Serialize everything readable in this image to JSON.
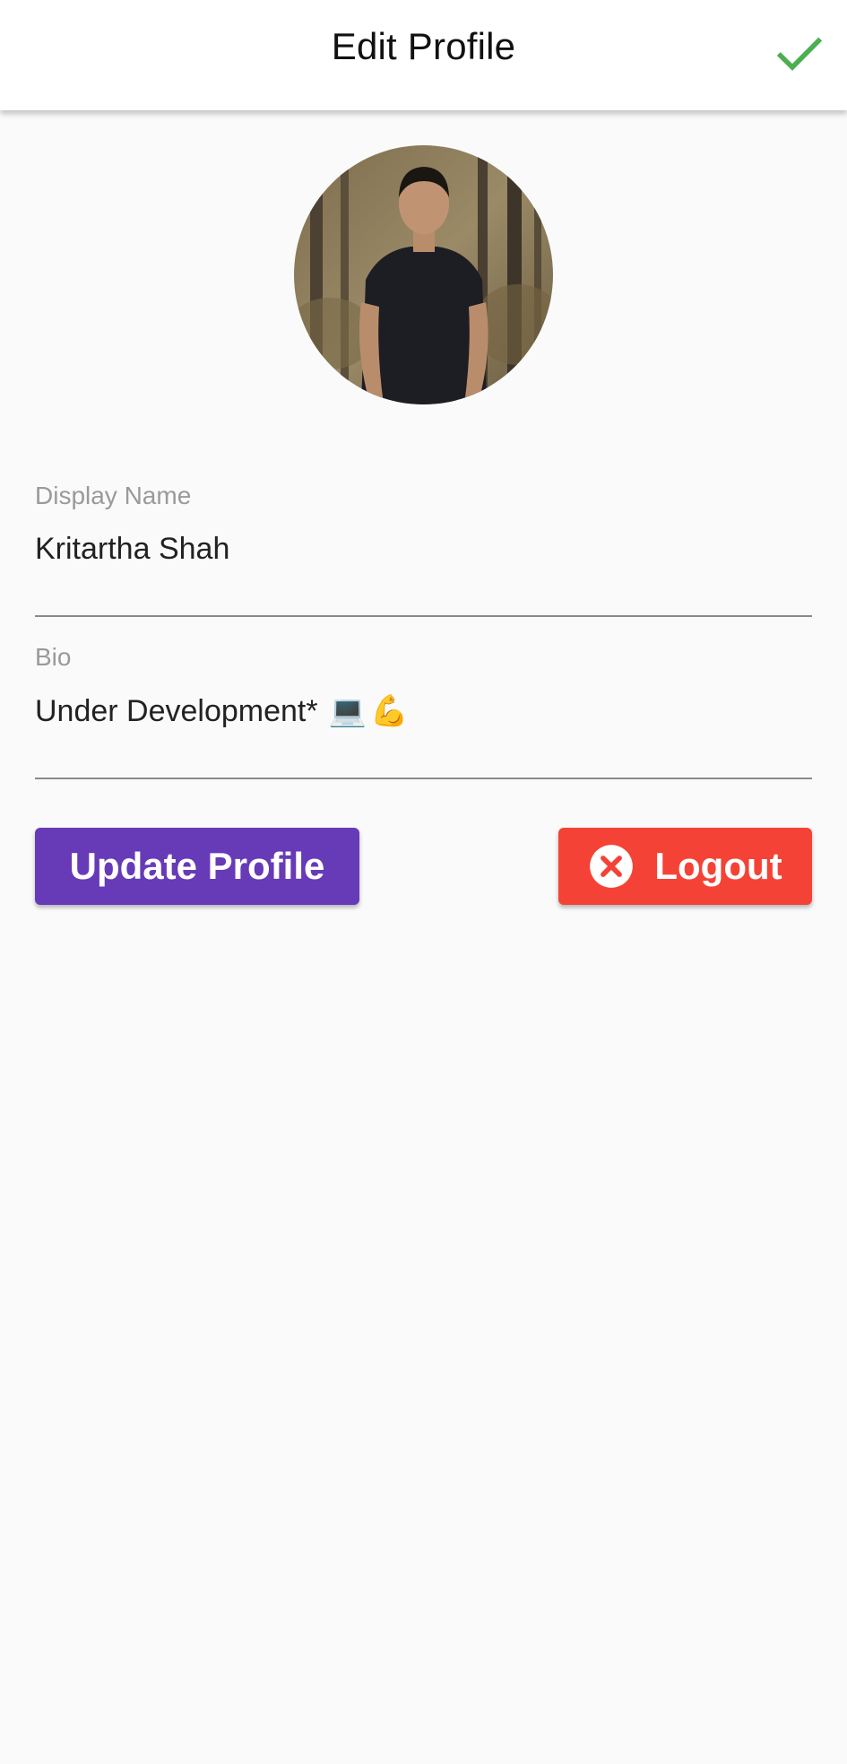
{
  "app_bar": {
    "title": "Edit Profile",
    "confirm_icon": "check-icon",
    "confirm_color": "#4caf50"
  },
  "profile": {
    "avatar": "profile-photo"
  },
  "fields": {
    "display_name": {
      "label": "Display Name",
      "value": "Kritartha Shah"
    },
    "bio": {
      "label": "Bio",
      "value": "Under Development*",
      "emojis": [
        "💻",
        "💪"
      ]
    }
  },
  "buttons": {
    "update": {
      "label": "Update Profile",
      "color": "#673ab7"
    },
    "logout": {
      "label": "Logout",
      "icon": "close-circle-icon",
      "color": "#f44336"
    }
  }
}
